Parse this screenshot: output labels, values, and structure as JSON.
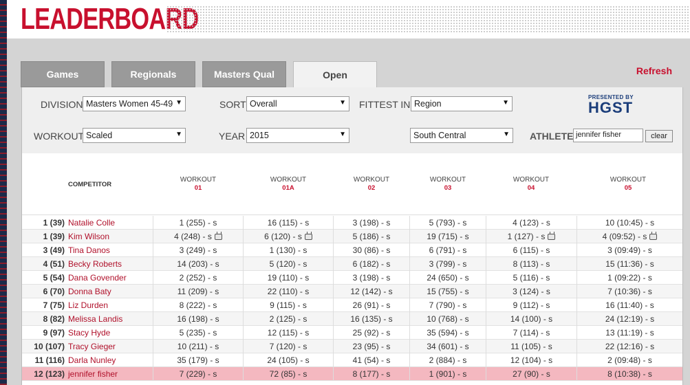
{
  "header": {
    "title": "LEADERBOARD"
  },
  "tabs": [
    {
      "label": "Games",
      "active": false
    },
    {
      "label": "Regionals",
      "active": false
    },
    {
      "label": "Masters Qual",
      "active": false
    },
    {
      "label": "Open",
      "active": true
    }
  ],
  "refresh_label": "Refresh",
  "filters": {
    "division_label": "DIVISION",
    "division_value": "Masters Women 45-49",
    "sort_label": "SORT",
    "sort_value": "Overall",
    "fittest_label": "FITTEST IN",
    "fittest_value": "Region",
    "workout_label": "WORKOUT",
    "workout_value": "Scaled",
    "year_label": "YEAR",
    "year_value": "2015",
    "region_value": "South Central",
    "athlete_label": "ATHLETE",
    "athlete_value": "jennifer fisher",
    "clear_label": "clear"
  },
  "sponsor": {
    "presented_by": "PRESENTED BY",
    "brand": "HGST"
  },
  "table": {
    "competitor_header": "COMPETITOR",
    "workouts": [
      {
        "label": "WORKOUT",
        "num": "01"
      },
      {
        "label": "WORKOUT",
        "num": "01A"
      },
      {
        "label": "WORKOUT",
        "num": "02"
      },
      {
        "label": "WORKOUT",
        "num": "03"
      },
      {
        "label": "WORKOUT",
        "num": "04"
      },
      {
        "label": "WORKOUT",
        "num": "05"
      }
    ],
    "rows": [
      {
        "rank": "1 (39)",
        "name": "Natalie Colle",
        "scores": [
          "1 (255) - s",
          "16 (115) - s",
          "3 (198) - s",
          "5 (793) - s",
          "4 (123) - s",
          "10 (10:45) - s"
        ],
        "video": [
          false,
          false,
          false,
          false,
          false,
          false
        ]
      },
      {
        "rank": "1 (39)",
        "name": "Kim Wilson",
        "scores": [
          "4 (248) - s",
          "6 (120) - s",
          "5 (186) - s",
          "19 (715) - s",
          "1 (127) - s",
          "4 (09:52) - s"
        ],
        "video": [
          true,
          true,
          false,
          false,
          true,
          true
        ]
      },
      {
        "rank": "3 (49)",
        "name": "Tina Danos",
        "scores": [
          "3 (249) - s",
          "1 (130) - s",
          "30 (86) - s",
          "6 (791) - s",
          "6 (115) - s",
          "3 (09:49) - s"
        ],
        "video": [
          false,
          false,
          false,
          false,
          false,
          false
        ]
      },
      {
        "rank": "4 (51)",
        "name": "Becky Roberts",
        "scores": [
          "14 (203) - s",
          "5 (120) - s",
          "6 (182) - s",
          "3 (799) - s",
          "8 (113) - s",
          "15 (11:36) - s"
        ],
        "video": [
          false,
          false,
          false,
          false,
          false,
          false
        ]
      },
      {
        "rank": "5 (54)",
        "name": "Dana Govender",
        "scores": [
          "2 (252) - s",
          "19 (110) - s",
          "3 (198) - s",
          "24 (650) - s",
          "5 (116) - s",
          "1 (09:22) - s"
        ],
        "video": [
          false,
          false,
          false,
          false,
          false,
          false
        ]
      },
      {
        "rank": "6 (70)",
        "name": "Donna Baty",
        "scores": [
          "11 (209) - s",
          "22 (110) - s",
          "12 (142) - s",
          "15 (755) - s",
          "3 (124) - s",
          "7 (10:36) - s"
        ],
        "video": [
          false,
          false,
          false,
          false,
          false,
          false
        ]
      },
      {
        "rank": "7 (75)",
        "name": "Liz Durden",
        "scores": [
          "8 (222) - s",
          "9 (115) - s",
          "26 (91) - s",
          "7 (790) - s",
          "9 (112) - s",
          "16 (11:40) - s"
        ],
        "video": [
          false,
          false,
          false,
          false,
          false,
          false
        ]
      },
      {
        "rank": "8 (82)",
        "name": "Melissa Landis",
        "scores": [
          "16 (198) - s",
          "2 (125) - s",
          "16 (135) - s",
          "10 (768) - s",
          "14 (100) - s",
          "24 (12:19) - s"
        ],
        "video": [
          false,
          false,
          false,
          false,
          false,
          false
        ]
      },
      {
        "rank": "9 (97)",
        "name": "Stacy Hyde",
        "scores": [
          "5 (235) - s",
          "12 (115) - s",
          "25 (92) - s",
          "35 (594) - s",
          "7 (114) - s",
          "13 (11:19) - s"
        ],
        "video": [
          false,
          false,
          false,
          false,
          false,
          false
        ]
      },
      {
        "rank": "10 (107)",
        "name": "Tracy Gieger",
        "scores": [
          "10 (211) - s",
          "7 (120) - s",
          "23 (95) - s",
          "34 (601) - s",
          "11 (105) - s",
          "22 (12:16) - s"
        ],
        "video": [
          false,
          false,
          false,
          false,
          false,
          false
        ]
      },
      {
        "rank": "11 (116)",
        "name": "Darla Nunley",
        "scores": [
          "35 (179) - s",
          "24 (105) - s",
          "41 (54) - s",
          "2 (884) - s",
          "12 (104) - s",
          "2 (09:48) - s"
        ],
        "video": [
          false,
          false,
          false,
          false,
          false,
          false
        ]
      },
      {
        "rank": "12 (123)",
        "name": "jennifer fisher",
        "scores": [
          "7 (229) - s",
          "72 (85) - s",
          "8 (177) - s",
          "1 (901) - s",
          "27 (90) - s",
          "8 (10:38) - s"
        ],
        "video": [
          false,
          false,
          false,
          false,
          false,
          false
        ],
        "highlight": true
      }
    ]
  }
}
